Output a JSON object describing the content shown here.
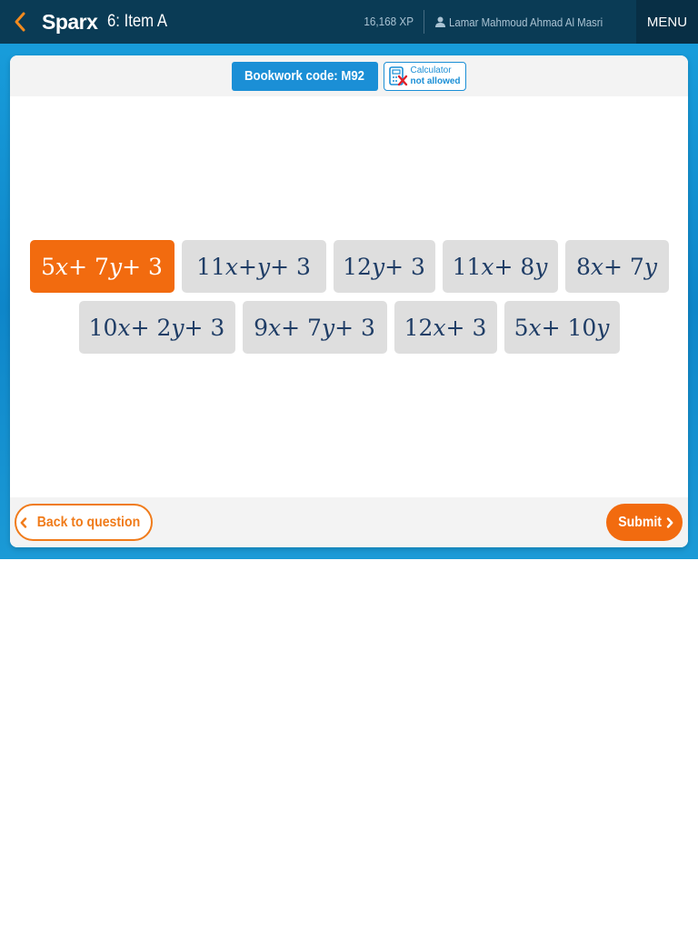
{
  "topbar": {
    "logo": "Sparx",
    "item_title": "6: Item A",
    "xp": "16,168 XP",
    "user_name": "Lamar Mahmoud Ahmad Al Masri",
    "menu_label": "MENU"
  },
  "header": {
    "bookwork_code": "Bookwork code: M92",
    "calculator_line1": "Calculator",
    "calculator_line2": "not allowed"
  },
  "options": {
    "row1": [
      {
        "label": "5x + 7y + 3",
        "selected": true
      },
      {
        "label": "11x + y + 3",
        "selected": false
      },
      {
        "label": "12y + 3",
        "selected": false
      },
      {
        "label": "11x + 8y",
        "selected": false
      },
      {
        "label": "8x + 7y",
        "selected": false
      }
    ],
    "row2": [
      {
        "label": "10x + 2y + 3",
        "selected": false
      },
      {
        "label": "9x + 7y + 3",
        "selected": false
      },
      {
        "label": "12x + 3",
        "selected": false
      },
      {
        "label": "5x + 10y",
        "selected": false
      }
    ]
  },
  "footer": {
    "back_label": "Back to question",
    "submit_label": "Submit"
  },
  "colors": {
    "accent_orange": "#f26b0f",
    "topbar_navy": "#0a3b55",
    "brand_blue": "#1b8fd6",
    "option_text": "#1f3d66"
  }
}
